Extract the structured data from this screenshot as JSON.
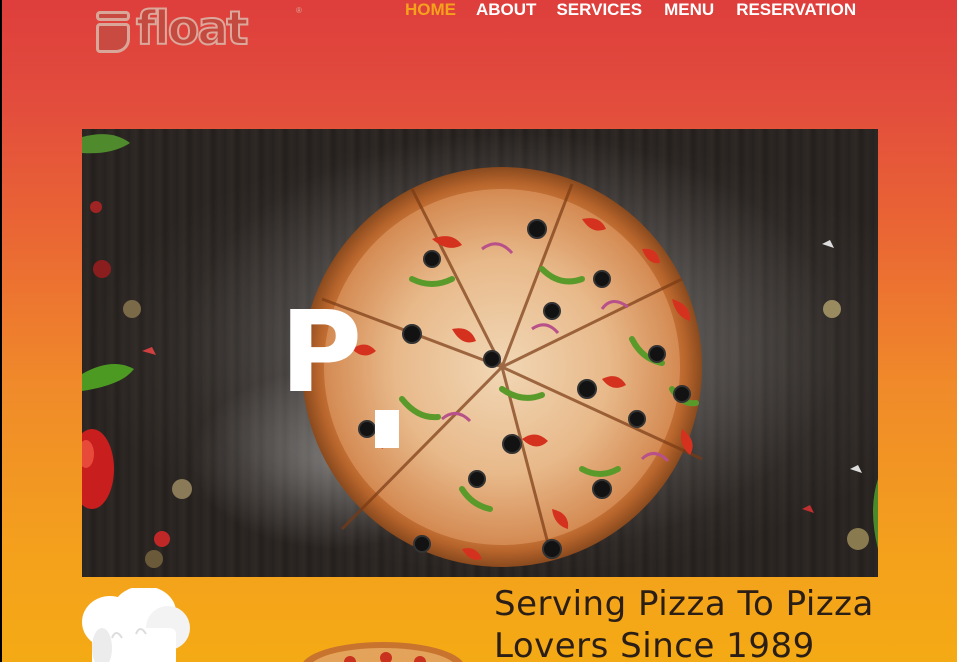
{
  "brand": {
    "name": "float",
    "reg_mark": "®",
    "colors": {
      "header_top": "#de3e3c",
      "header_bottom": "#f4aa14",
      "nav_active": "#f4a21c",
      "nav_text": "#ffffff"
    }
  },
  "nav": {
    "items": [
      {
        "label": "HOME",
        "active": true
      },
      {
        "label": "ABOUT",
        "active": false
      },
      {
        "label": "SERVICES",
        "active": false
      },
      {
        "label": "MENU",
        "active": false
      },
      {
        "label": "RESERVATION",
        "active": false
      }
    ]
  },
  "hero": {
    "image": "pizza-on-dark-wood-table",
    "overlay_letters": [
      "P",
      "I"
    ]
  },
  "intro": {
    "tagline_line1": "Serving Pizza To Pizza",
    "tagline_line2": "Lovers Since 1989",
    "illustrations": [
      "chef-hat",
      "pizza"
    ]
  }
}
